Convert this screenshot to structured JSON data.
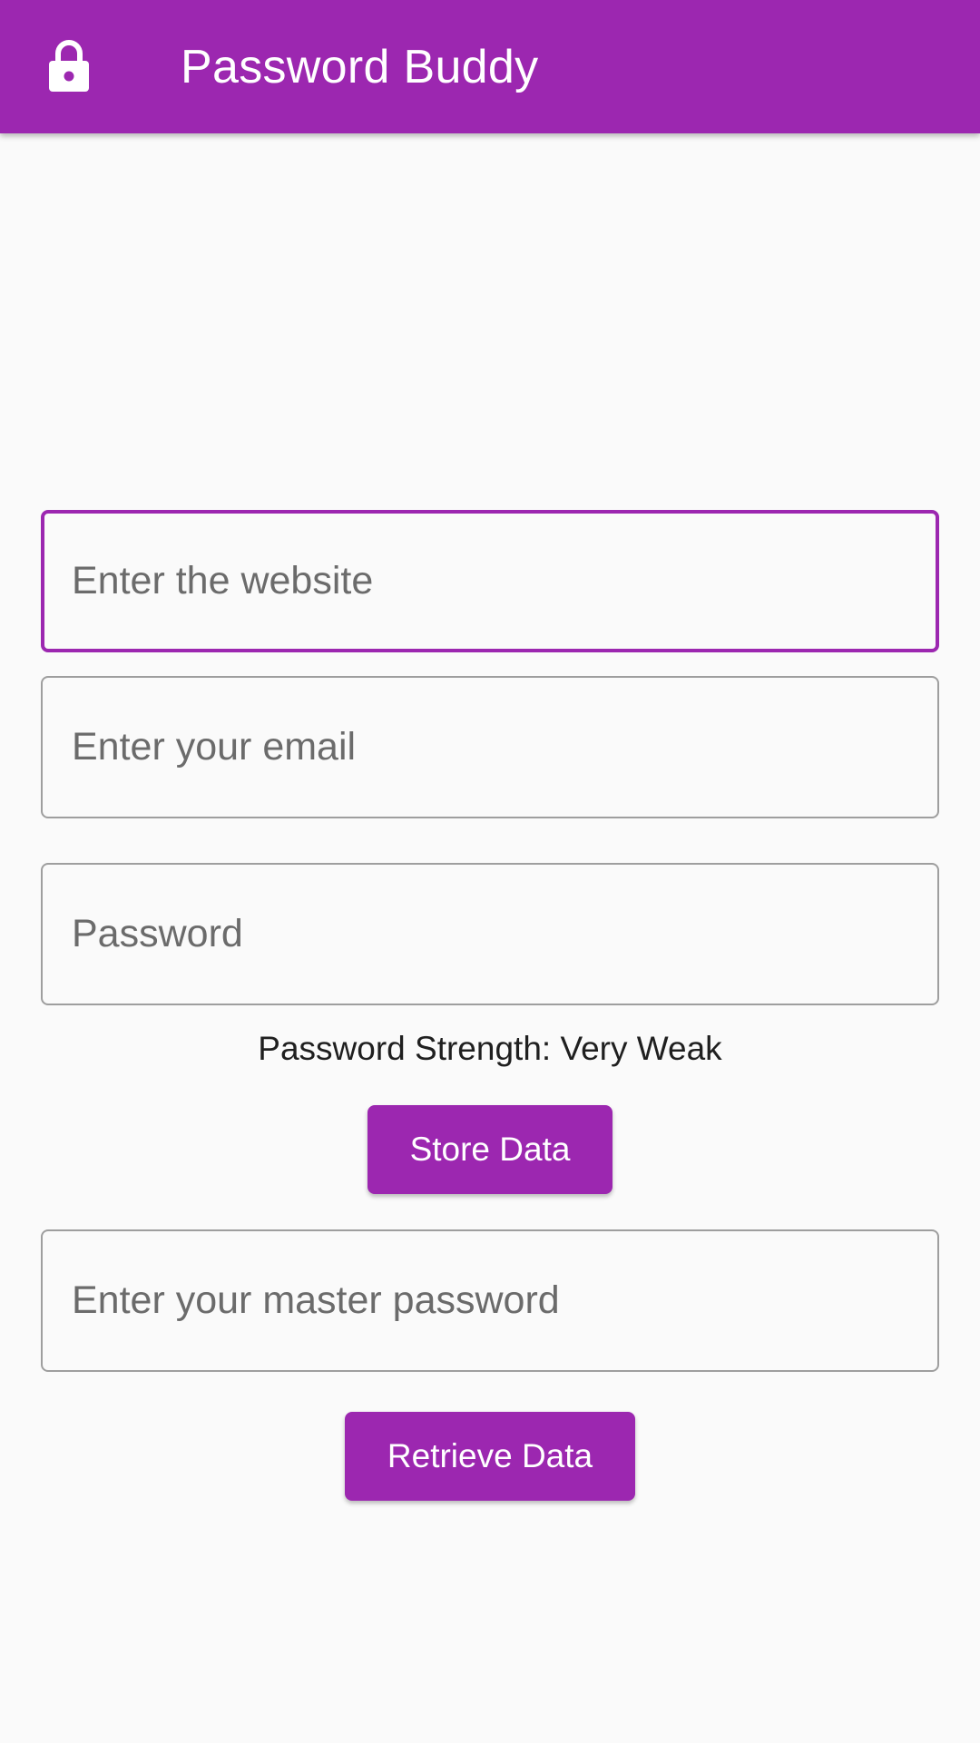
{
  "app_bar": {
    "title": "Password Buddy",
    "icon": "lock-icon",
    "color": "#9c27b0"
  },
  "form": {
    "website_placeholder": "Enter the website",
    "email_placeholder": "Enter your email",
    "password_placeholder": "Password",
    "password_strength": "Password Strength: Very Weak",
    "store_button": "Store Data",
    "master_password_placeholder": "Enter your master password",
    "retrieve_button": "Retrieve Data"
  },
  "theme": {
    "accent": "#9c27b0",
    "background": "#fafafa"
  }
}
